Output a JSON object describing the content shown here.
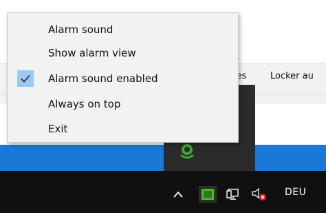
{
  "background": {
    "tabs": [
      {
        "label": "ies"
      },
      {
        "label": "Locker au"
      }
    ]
  },
  "context_menu": {
    "items": [
      {
        "label": "Alarm sound",
        "checked": false
      },
      {
        "label": "Show alarm view",
        "checked": false
      },
      {
        "label": "Alarm sound enabled",
        "checked": true
      },
      {
        "label": "Always on top",
        "checked": false
      },
      {
        "label": "Exit",
        "checked": false
      }
    ]
  },
  "taskbar": {
    "language": "DEU",
    "icons": [
      "chevron-up-icon",
      "app-tray-icon",
      "network-icon",
      "volume-muted-icon"
    ]
  },
  "colors": {
    "taskbar_bg": "#101010",
    "accent_blue": "#1a78d6",
    "menu_bg": "#f2f2f2",
    "check_highlight": "#9bc8f2",
    "mute_red": "#e81123",
    "tray_green": "#4cba27"
  }
}
